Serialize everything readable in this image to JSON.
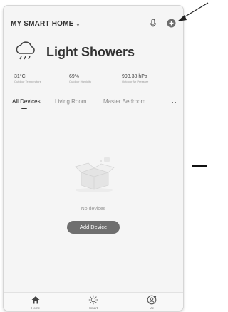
{
  "header": {
    "home_title": "MY SMART HOME"
  },
  "weather": {
    "condition": "Light Showers",
    "stats": [
      {
        "value": "31°C",
        "label": "Outdoor Temperature"
      },
      {
        "value": "69%",
        "label": "Outdoor Humidity"
      },
      {
        "value": "993.38 hPa",
        "label": "Outdoor Air Pressure"
      }
    ]
  },
  "tabs": [
    "All Devices",
    "Living Room",
    "Master Bedroom"
  ],
  "more_label": "···",
  "empty": {
    "message": "No devices",
    "button_label": "Add Device"
  },
  "tabbar": [
    {
      "label": "Home",
      "icon": "home-icon"
    },
    {
      "label": "Smart",
      "icon": "sun-icon"
    },
    {
      "label": "Me",
      "icon": "profile-icon"
    }
  ]
}
